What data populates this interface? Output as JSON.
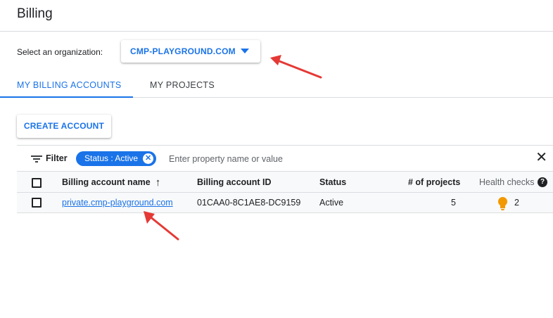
{
  "header": {
    "title": "Billing"
  },
  "org": {
    "label": "Select an organization:",
    "value": "CMP-PLAYGROUND.COM"
  },
  "tabs": [
    {
      "label": "MY BILLING ACCOUNTS",
      "active": true
    },
    {
      "label": "MY PROJECTS",
      "active": false
    }
  ],
  "create_button": "CREATE ACCOUNT",
  "filter": {
    "label": "Filter",
    "chip": "Status : Active",
    "placeholder": "Enter property name or value"
  },
  "table": {
    "columns": [
      "Billing account name",
      "Billing account ID",
      "Status",
      "# of projects",
      "Health checks"
    ],
    "rows": [
      {
        "name": "private.cmp-playground.com",
        "id": "01CAA0-8C1AE8-DC9159",
        "status": "Active",
        "projects": "5",
        "health": "2"
      }
    ]
  },
  "colors": {
    "accent": "#1a73e8",
    "annotation": "#e53935",
    "warning": "#f29900"
  },
  "icons": [
    "dropdown-caret-icon",
    "filter-icon",
    "chip-close-icon",
    "clear-filter-icon",
    "sort-ascending-icon",
    "help-icon",
    "lightbulb-icon"
  ]
}
